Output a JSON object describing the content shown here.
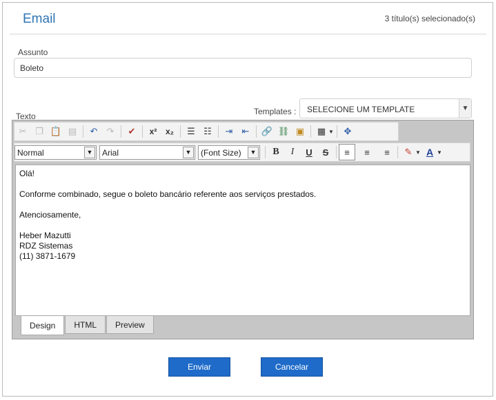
{
  "header": {
    "title": "Email",
    "selected_count": "3 título(s) selecionado(s)"
  },
  "subject": {
    "label": "Assunto",
    "value": "Boleto"
  },
  "body_label": "Texto",
  "templates": {
    "label": "Templates :",
    "selected": "SELECIONE UM TEMPLATE"
  },
  "toolbar": {
    "paragraph_format": "Normal",
    "font_name": "Arial",
    "font_size": "(Font Size)",
    "bold": "B",
    "italic": "I",
    "underline": "U",
    "strike": "S",
    "superscript": "x²",
    "subscript": "x₂",
    "font_color": "A"
  },
  "content_lines": [
    "Olá!",
    "",
    "Conforme combinado, segue o boleto bancário referente aos serviços prestados.",
    "",
    "Atenciosamente,",
    "",
    "Heber Mazutti",
    "RDZ Sistemas",
    "(11) 3871-1679"
  ],
  "mode_tabs": [
    "Design",
    "HTML",
    "Preview"
  ],
  "actions": {
    "send": "Enviar",
    "cancel": "Cancelar"
  },
  "colors": {
    "accent": "#2e75b6",
    "button": "#1f6bc9"
  }
}
